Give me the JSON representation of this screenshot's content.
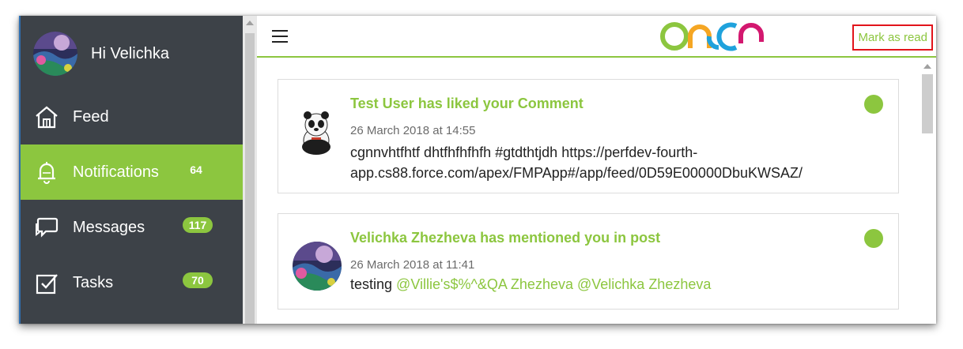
{
  "sidebar": {
    "greeting": "Hi Velichka",
    "items": [
      {
        "label": "Feed",
        "icon": "home-icon",
        "badge": ""
      },
      {
        "label": "Notifications",
        "icon": "bell-icon",
        "badge": "64",
        "active": true
      },
      {
        "label": "Messages",
        "icon": "chat-bubble-icon",
        "badge": "117"
      },
      {
        "label": "Tasks",
        "icon": "checkbox-icon",
        "badge": "70"
      }
    ]
  },
  "header": {
    "menu_icon": "hamburger-icon",
    "logo_icon": "brand-logo",
    "mark_as_read": "Mark as read"
  },
  "notifications": [
    {
      "title": "Test User has liked your Comment",
      "time": "26 March 2018 at 14:55",
      "body_line1": "cgnnvhtfhtf dhtfhfhfhfh #gtdthtjdh https://perfdev-fourth-",
      "body_line2": "app.cs88.force.com/apex/FMPApp#/app/feed/0D59E00000DbuKWSAZ/",
      "avatar_icon": "panda-avatar-icon"
    },
    {
      "title": "Velichka Zhezheva has mentioned you in post",
      "time": "26 March 2018 at 11:41",
      "body_text": "testing ",
      "mention1": "@Villie's$%^&QA Zhezheva",
      "mention2": "@Velichka Zhezheva",
      "avatar_icon": "user-avatar-icon"
    }
  ],
  "colors": {
    "accent": "#8cc63f",
    "sidebar_bg": "#3d4248",
    "highlight_border": "#e2141b",
    "logo_blue": "#1fa2dc",
    "logo_pink": "#d3186f"
  }
}
